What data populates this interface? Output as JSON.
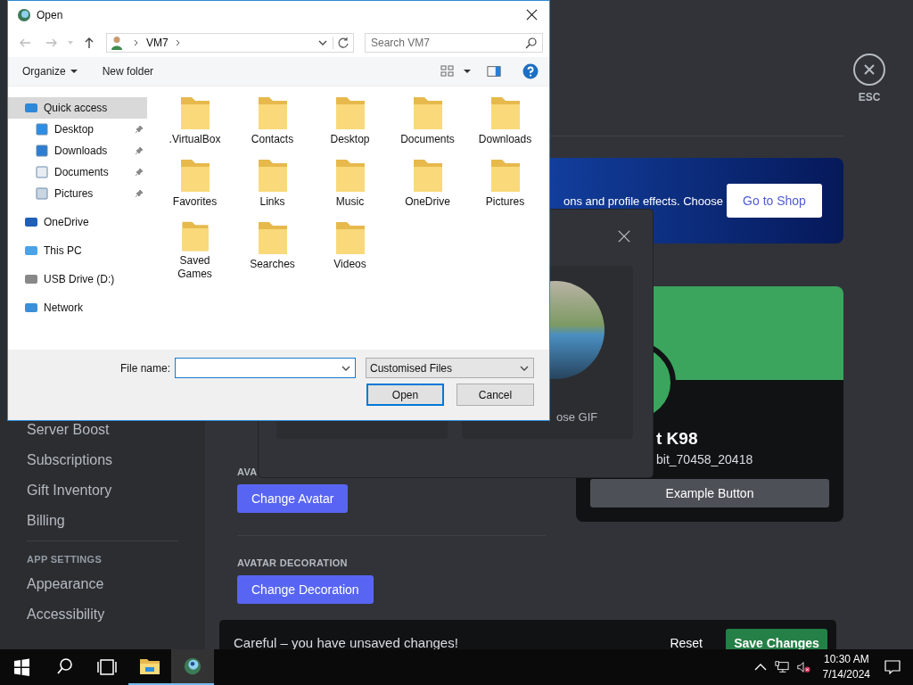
{
  "discord": {
    "sidebar": {
      "items": [
        {
          "label": "Server Boost"
        },
        {
          "label": "Subscriptions"
        },
        {
          "label": "Gift Inventory"
        },
        {
          "label": "Billing"
        }
      ],
      "sections": [
        {
          "heading": "APP SETTINGS",
          "items": [
            {
              "label": "Appearance"
            },
            {
              "label": "Accessibility"
            }
          ]
        }
      ]
    },
    "esc": {
      "label": "ESC"
    },
    "banner": {
      "text": "ons and profile effects. Choose",
      "button": "Go to Shop"
    },
    "avatar": {
      "heading": "AVA",
      "button": "Change Avatar"
    },
    "decoration": {
      "heading": "AVATAR DECORATION",
      "button": "Change Decoration"
    },
    "profile": {
      "name": "t K98",
      "username": "bit_70458_20418",
      "button": "Example Button"
    },
    "modal": {
      "gif_label": "ose GIF"
    },
    "unsaved_bar": {
      "message": "Careful – you have unsaved changes!",
      "reset": "Reset",
      "save": "Save Changes"
    }
  },
  "dialog": {
    "title": "Open",
    "address": [
      "VM7"
    ],
    "search": {
      "placeholder": "Search VM7"
    },
    "toolbar": {
      "organize": "Organize",
      "new_folder": "New folder"
    },
    "nav": [
      {
        "label": "Quick access",
        "selected": true,
        "children": [
          {
            "label": "Desktop",
            "pinned": true
          },
          {
            "label": "Downloads",
            "pinned": true
          },
          {
            "label": "Documents",
            "pinned": true
          },
          {
            "label": "Pictures",
            "pinned": true
          }
        ]
      },
      {
        "label": "OneDrive",
        "selected": false
      },
      {
        "label": "This PC",
        "selected": false
      },
      {
        "label": "USB Drive (D:)",
        "selected": false
      },
      {
        "label": "Network",
        "selected": false
      }
    ],
    "files": [
      {
        "name": ".VirtualBox"
      },
      {
        "name": "Contacts"
      },
      {
        "name": "Desktop"
      },
      {
        "name": "Documents"
      },
      {
        "name": "Downloads"
      },
      {
        "name": "Favorites"
      },
      {
        "name": "Links"
      },
      {
        "name": "Music"
      },
      {
        "name": "OneDrive"
      },
      {
        "name": "Pictures"
      },
      {
        "name": "Saved Games"
      },
      {
        "name": "Searches"
      },
      {
        "name": "Videos"
      }
    ],
    "file_name": {
      "label": "File name:"
    },
    "file_type": "Customised Files",
    "buttons": [
      {
        "label": "Open",
        "default": true
      },
      {
        "label": "Cancel",
        "default": false
      }
    ]
  },
  "taskbar": {
    "apps": [
      {
        "kind": "explorer",
        "active": false
      },
      {
        "kind": "app",
        "active": true
      }
    ],
    "time": "10:30 AM",
    "date": "7/14/2024"
  }
}
